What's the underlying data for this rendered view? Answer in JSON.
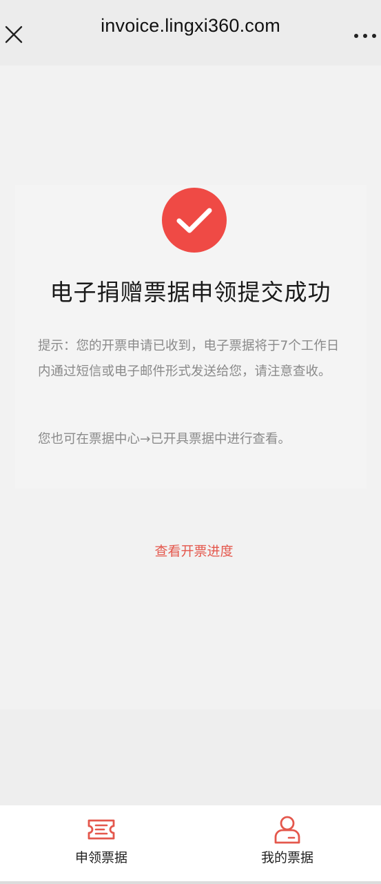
{
  "browser": {
    "url_title": "invoice.lingxi360.com",
    "close_icon": "close-icon",
    "more_icon": "more-icon"
  },
  "result": {
    "icon": "checkmark-circle-icon",
    "title": "电子捐赠票据申领提交成功",
    "tip": "提示：您的开票申请已收到，电子票据将于7个工作日内通过短信或电子邮件形式发送给您，请注意查收。",
    "tip2": "您也可在票据中心→已开具票据中进行查看。"
  },
  "actions": {
    "view_progress": "查看开票进度"
  },
  "bottom_nav": {
    "items": [
      {
        "label": "申领票据",
        "icon": "ticket-icon"
      },
      {
        "label": "我的票据",
        "icon": "user-icon"
      }
    ]
  },
  "colors": {
    "accent": "#e4574c",
    "success_circle": "#ef4a45"
  }
}
